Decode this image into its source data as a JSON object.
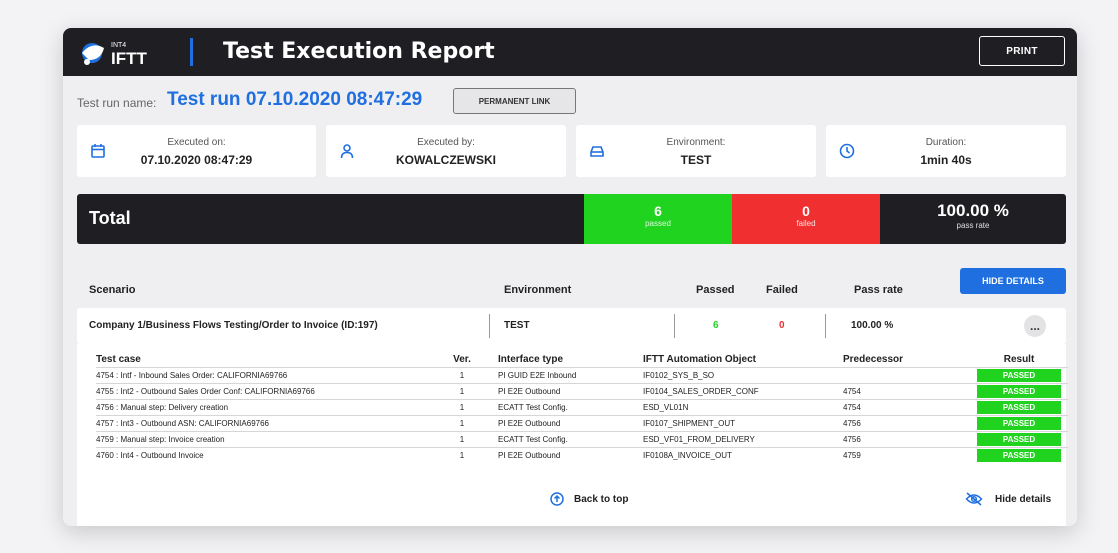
{
  "header": {
    "logo_text": "IFTT",
    "logo_sup": "INT4",
    "title": "Test Execution Report",
    "print_label": "PRINT"
  },
  "run": {
    "name_label": "Test run name:",
    "name_value": "Test run 07.10.2020 08:47:29",
    "permanent_link_label": "PERMANENT LINK"
  },
  "info": [
    {
      "icon": "calendar-icon",
      "label": "Executed on:",
      "value": "07.10.2020 08:47:29"
    },
    {
      "icon": "person-icon",
      "label": "Executed by:",
      "value": "KOWALCZEWSKI"
    },
    {
      "icon": "server-icon",
      "label": "Environment:",
      "value": "TEST"
    },
    {
      "icon": "clock-icon",
      "label": "Duration:",
      "value": "1min 40s"
    }
  ],
  "total": {
    "label": "Total",
    "passed_count": "6",
    "passed_label": "passed",
    "failed_count": "0",
    "failed_label": "failed",
    "pass_rate": "100.00 %",
    "pass_rate_label": "pass rate"
  },
  "scenario_headers": {
    "scenario": "Scenario",
    "environment": "Environment",
    "passed": "Passed",
    "failed": "Failed",
    "pass_rate": "Pass rate",
    "hide_details_button": "HIDE DETAILS"
  },
  "scenario": {
    "name": "Company 1/Business Flows Testing/Order to Invoice (ID:197)",
    "environment": "TEST",
    "passed": "6",
    "failed": "0",
    "pass_rate": "100.00 %",
    "more": "..."
  },
  "details": {
    "headers": [
      "Test case",
      "Ver.",
      "Interface type",
      "IFTT Automation Object",
      "Predecessor",
      "Result"
    ],
    "rows": [
      [
        "4754 : Intf - Inbound Sales Order: CALIFORNIA69766",
        "1",
        "PI GUID E2E Inbound",
        "IF0102_SYS_B_SO",
        "",
        "PASSED"
      ],
      [
        "4755 : Int2 - Outbound Sales Order Conf: CALIFORNIA69766",
        "1",
        "PI E2E Outbound",
        "IF0104_SALES_ORDER_CONF",
        "4754",
        "PASSED"
      ],
      [
        "4756 : Manual step: Delivery creation",
        "1",
        "ECATT Test Config.",
        "ESD_VL01N",
        "4754",
        "PASSED"
      ],
      [
        "4757 : Int3 - Outbound ASN: CALIFORNIA69766",
        "1",
        "PI E2E Outbound",
        "IF0107_SHIPMENT_OUT",
        "4756",
        "PASSED"
      ],
      [
        "4759 : Manual step: Invoice creation",
        "1",
        "ECATT Test Config.",
        "ESD_VF01_FROM_DELIVERY",
        "4756",
        "PASSED"
      ],
      [
        "4760 : Int4 - Outbound Invoice",
        "1",
        "PI E2E Outbound",
        "IF0108A_INVOICE_OUT",
        "4759",
        "PASSED"
      ]
    ],
    "back_to_top": "Back to top",
    "hide_details": "Hide details"
  },
  "colors": {
    "accent": "#1f6fe0",
    "dark": "#1f1f23",
    "passed": "#1fd31f",
    "failed": "#f03030"
  }
}
